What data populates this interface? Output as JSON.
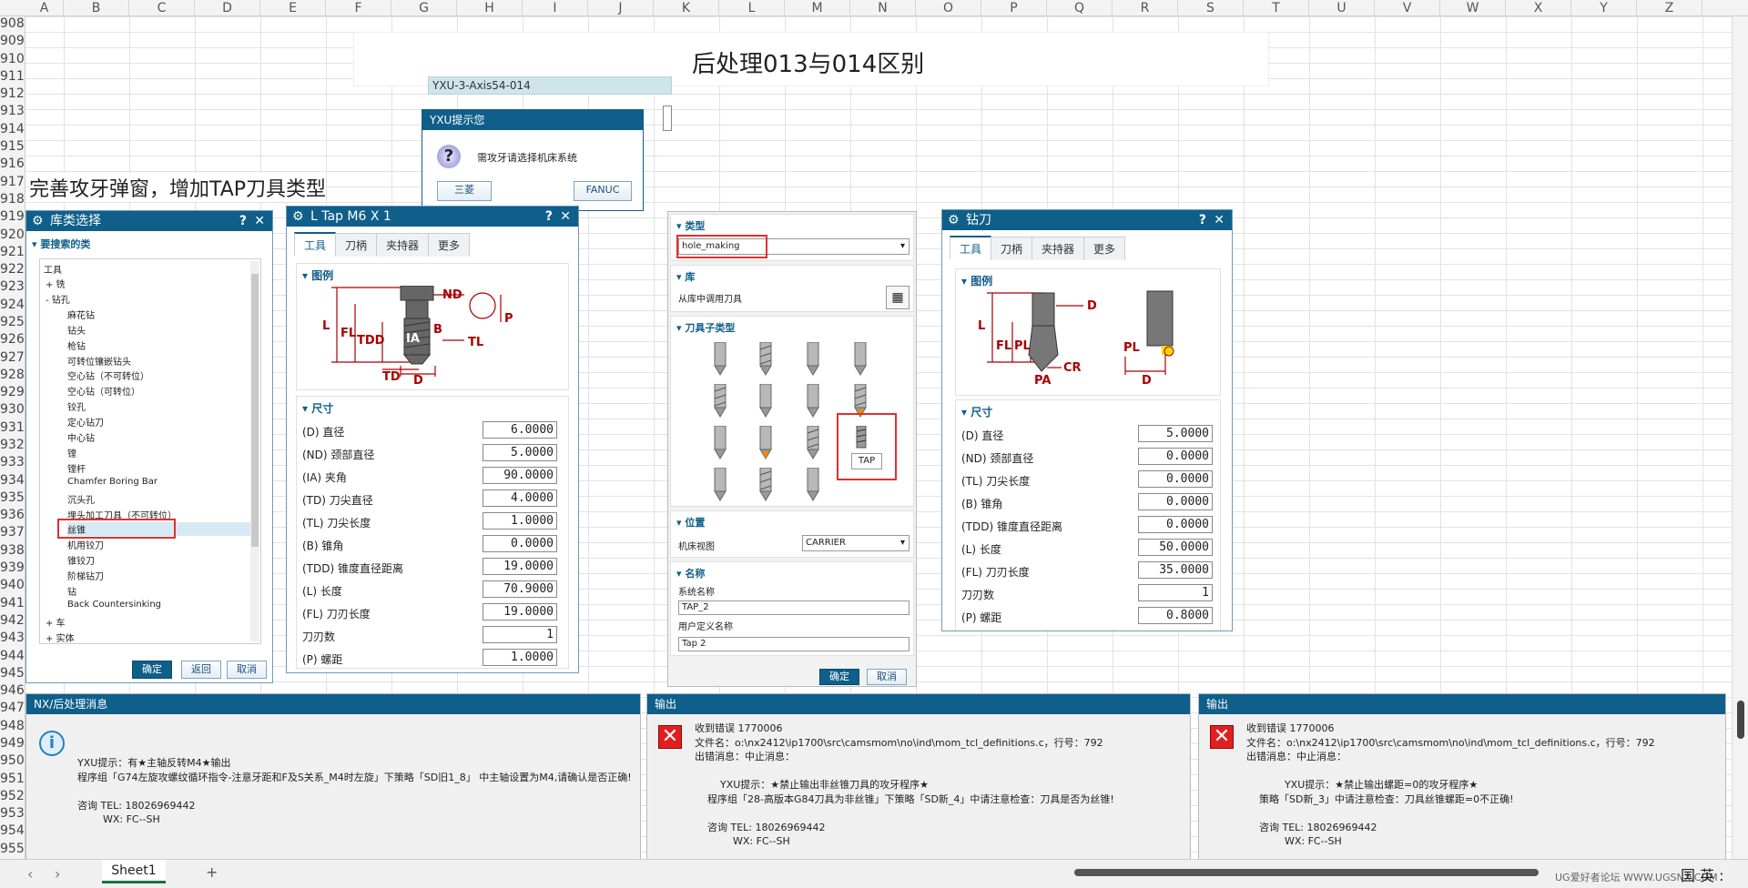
{
  "sheet": {
    "columns": [
      "A",
      "B",
      "C",
      "D",
      "E",
      "F",
      "G",
      "H",
      "I",
      "J",
      "K",
      "L",
      "M",
      "N",
      "O",
      "P",
      "Q",
      "R",
      "S",
      "T",
      "U",
      "V",
      "W",
      "X",
      "Y",
      "Z"
    ],
    "rows": [
      "908",
      "909",
      "910",
      "911",
      "912",
      "913",
      "914",
      "915",
      "916",
      "917",
      "918",
      "919",
      "920",
      "921",
      "922",
      "923",
      "924",
      "925",
      "926",
      "927",
      "928",
      "929",
      "930",
      "931",
      "932",
      "933",
      "934",
      "935",
      "936",
      "937",
      "938",
      "939",
      "940",
      "941",
      "942",
      "943",
      "944",
      "945",
      "946",
      "947",
      "948",
      "949",
      "950",
      "951",
      "952",
      "953",
      "954",
      "955"
    ],
    "title": "后处理013与014区别",
    "heading": "完善攻牙弹窗，增加TAP刀具类型",
    "tab_name": "Sheet1",
    "add_sheet": "+",
    "nav_prev": "‹",
    "nav_next": "›",
    "status_right": "国 英 :",
    "watermark": "UG爱好者论坛 WWW.UGSNX.COM"
  },
  "label_yxu": "YXU-3-Axis54-014",
  "prompt_dialog": {
    "title": "YXU提示您",
    "message": "需攻牙请选择机床系统",
    "btn_left": "三菱",
    "btn_right": "FANUC"
  },
  "library_dialog": {
    "title": "库类选择",
    "help": "?",
    "close": "✕",
    "section": "要搜索的类",
    "tree_root": "工具",
    "tree": [
      {
        "label": "+ 铣",
        "indent": 0
      },
      {
        "label": "- 钻孔",
        "indent": 0
      },
      {
        "label": "麻花钻",
        "indent": 2
      },
      {
        "label": "钻头",
        "indent": 2
      },
      {
        "label": "枪钻",
        "indent": 2
      },
      {
        "label": "可转位镶嵌钻头",
        "indent": 2
      },
      {
        "label": "空心钻（不可转位）",
        "indent": 2
      },
      {
        "label": "空心钻（可转位）",
        "indent": 2
      },
      {
        "label": "铰孔",
        "indent": 2
      },
      {
        "label": "定心钻刀",
        "indent": 2
      },
      {
        "label": "中心钻",
        "indent": 2
      },
      {
        "label": "镗",
        "indent": 2
      },
      {
        "label": "镗杆",
        "indent": 2
      },
      {
        "label": "Chamfer Boring Bar",
        "indent": 2
      },
      {
        "label": "沉头孔",
        "indent": 2
      },
      {
        "label": "埋头加工刀具（不可转位）",
        "indent": 2
      },
      {
        "label": "丝锥",
        "indent": 2
      },
      {
        "label": "机用铰刀",
        "indent": 2
      },
      {
        "label": "锥铰刀",
        "indent": 2
      },
      {
        "label": "阶梯钻刀",
        "indent": 2
      },
      {
        "label": "钻",
        "indent": 2
      },
      {
        "label": "Back Countersinking",
        "indent": 2
      },
      {
        "label": "+ 车",
        "indent": 0
      },
      {
        "label": "+ 实体",
        "indent": 0
      }
    ],
    "ok": "确定",
    "back": "返回",
    "cancel": "取消"
  },
  "tap_dialog": {
    "title": "L Tap M6 X 1",
    "help": "?",
    "close": "✕",
    "tabs": [
      "工具",
      "刀柄",
      "夹持器",
      "更多"
    ],
    "legend": "图例",
    "dims": "尺寸",
    "fig_labels": [
      "ND",
      "L",
      "FL",
      "TDD",
      "IA",
      "B",
      "TD",
      "D",
      "TL",
      "P"
    ],
    "params": [
      {
        "label": "(D) 直径",
        "value": "6.0000"
      },
      {
        "label": "(ND) 颈部直径",
        "value": "5.0000"
      },
      {
        "label": "(IA) 夹角",
        "value": "90.0000"
      },
      {
        "label": "(TD) 刀尖直径",
        "value": "4.0000"
      },
      {
        "label": "(TL) 刀尖长度",
        "value": "1.0000"
      },
      {
        "label": "(B) 锥角",
        "value": "0.0000"
      },
      {
        "label": "(TDD) 锥度直径距离",
        "value": "19.0000"
      },
      {
        "label": "(L) 长度",
        "value": "70.9000"
      },
      {
        "label": "(FL) 刀刃长度",
        "value": "19.0000"
      },
      {
        "label": "刀刃数",
        "value": "1"
      },
      {
        "label": "(P) 螺距",
        "value": "1.0000"
      }
    ]
  },
  "type_dialog": {
    "type_section": "类型",
    "type_value": "hole_making",
    "lib_section": "库",
    "lib_label": "从库中调用刀具",
    "subtype_section": "刀具子类型",
    "tap_tooltip": "TAP",
    "pos_section": "位置",
    "pos_label": "机床视图",
    "pos_value": "CARRIER",
    "name_section": "名称",
    "sys_name_label": "系统名称",
    "sys_name": "TAP_2",
    "user_name_label": "用户定义名称",
    "user_name": "Tap 2",
    "ok": "确定",
    "cancel": "取消"
  },
  "drill_dialog": {
    "title": "钻刀",
    "help": "?",
    "close": "✕",
    "tabs": [
      "工具",
      "刀柄",
      "夹持器",
      "更多"
    ],
    "legend": "图例",
    "dims": "尺寸",
    "fig_labels": [
      "D",
      "L",
      "FL",
      "PL",
      "CR",
      "PA",
      "PL",
      "D"
    ],
    "params": [
      {
        "label": "(D) 直径",
        "value": "5.0000"
      },
      {
        "label": "(ND) 颈部直径",
        "value": "0.0000"
      },
      {
        "label": "(TL) 刀尖长度",
        "value": "0.0000"
      },
      {
        "label": "(B) 锥角",
        "value": "0.0000"
      },
      {
        "label": "(TDD) 锥度直径距离",
        "value": "0.0000"
      },
      {
        "label": "(L) 长度",
        "value": "50.0000"
      },
      {
        "label": "(FL) 刀刃长度",
        "value": "35.0000"
      },
      {
        "label": "刀刃数",
        "value": "1"
      },
      {
        "label": "(P) 螺距",
        "value": "0.8000"
      }
    ]
  },
  "panel1": {
    "title": "NX/后处理消息",
    "lines": [
      "YXU提示：有★主轴反转M4★输出",
      "程序组「G74左旋攻螺纹循环指令-注意牙距和F及S关系_M4时左旋」下策略「SD旧1_8」 中主轴设置为M4,请确认是否正确!",
      "",
      "咨询 TEL: 18026969442",
      "        WX: FC--SH"
    ]
  },
  "panel2": {
    "title": "输出",
    "lines": [
      "收到错误 1770006",
      "文件名：o:\\nx2412\\ip1700\\src\\camsmom\\no\\ind\\mom_tcl_definitions.c，行号：792",
      "出错消息：中止消息：",
      "",
      "        YXU提示：★禁止输出非丝锥刀具的攻牙程序★",
      "    程序组「28-高版本G84刀具为非丝锥」下策略「SD新_4」中请注意检查：刀具是否为丝锥!",
      "",
      "    咨询 TEL: 18026969442",
      "            WX: FC--SH"
    ]
  },
  "panel3": {
    "title": "输出",
    "lines": [
      "收到错误 1770006",
      "文件名：o:\\nx2412\\ip1700\\src\\camsmom\\no\\ind\\mom_tcl_definitions.c，行号：792",
      "出错消息：中止消息：",
      "",
      "            YXU提示：★禁止输出螺距=0的攻牙程序★",
      "    策略「SD新_3」中请注意检查：刀具丝锥螺距=0不正确!",
      "",
      "    咨询 TEL: 18026969442",
      "            WX: FC--SH"
    ]
  }
}
